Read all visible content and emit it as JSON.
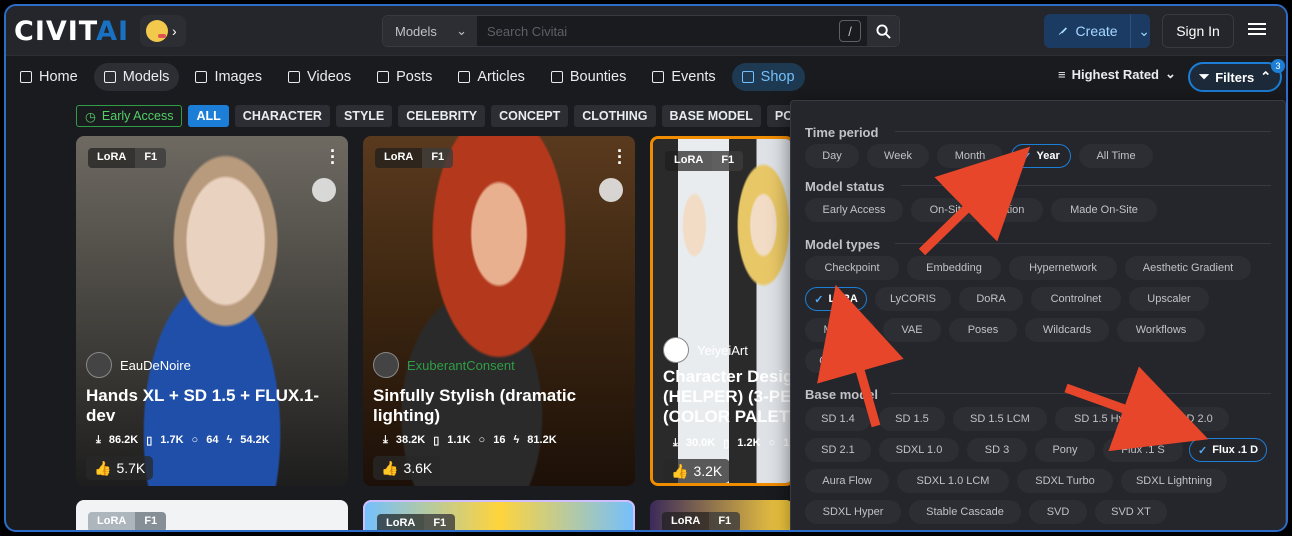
{
  "header": {
    "logo_civit": "CIVIT",
    "logo_ai": "AI",
    "search_select": "Models",
    "search_placeholder": "Search Civitai",
    "search_shortcut": "/",
    "create_label": "Create",
    "signin_label": "Sign In"
  },
  "nav": {
    "items": [
      "Home",
      "Models",
      "Images",
      "Videos",
      "Posts",
      "Articles",
      "Bounties",
      "Events",
      "Shop"
    ],
    "sort_label": "Highest Rated",
    "filters_label": "Filters",
    "filters_count": "3"
  },
  "chips": [
    "Early Access",
    "ALL",
    "CHARACTER",
    "STYLE",
    "CELEBRITY",
    "CONCEPT",
    "CLOTHING",
    "BASE MODEL",
    "POSES"
  ],
  "cards": [
    {
      "tag1": "LoRA",
      "tag2": "F1",
      "author": "EauDeNoire",
      "title": "Hands XL + SD 1.5 + FLUX.1-dev",
      "downloads": "86.2K",
      "saves": "1.7K",
      "comments": "64",
      "buzz": "54.2K",
      "likes": "5.7K"
    },
    {
      "tag1": "LoRA",
      "tag2": "F1",
      "author": "ExuberantConsent",
      "title": "Sinfully Stylish (dramatic lighting)",
      "downloads": "38.2K",
      "saves": "1.1K",
      "comments": "16",
      "buzz": "81.2K",
      "likes": "3.6K"
    },
    {
      "tag1": "LoRA",
      "tag2": "F1",
      "author": "YeiyeiArt",
      "title": "Character Desig (HELPER) (3-PE (COLOR PALETT",
      "downloads": "30.0K",
      "saves": "1.2K",
      "comments": "1",
      "buzz": "",
      "likes": "3.2K"
    },
    {
      "tag1": "LoRA",
      "tag2": "F1"
    },
    {
      "tag1": "LoRA",
      "tag2": "F1"
    },
    {
      "tag1": "LoRA",
      "tag2": "F1"
    }
  ],
  "filters": {
    "time_period": {
      "title": "Time period",
      "options": [
        "Day",
        "Week",
        "Month",
        "Year",
        "All Time"
      ],
      "selected": "Year"
    },
    "model_status": {
      "title": "Model status",
      "options": [
        "Early Access",
        "On-Site Generation",
        "Made On-Site"
      ]
    },
    "model_types": {
      "title": "Model types",
      "options": [
        "Checkpoint",
        "Embedding",
        "Hypernetwork",
        "Aesthetic Gradient",
        "LoRA",
        "LyCORIS",
        "DoRA",
        "Controlnet",
        "Upscaler",
        "Motion",
        "VAE",
        "Poses",
        "Wildcards",
        "Workflows",
        "Other"
      ],
      "selected": "LoRA"
    },
    "base_model": {
      "title": "Base model",
      "options": [
        "SD 1.4",
        "SD 1.5",
        "SD 1.5 LCM",
        "SD 1.5 Hyper",
        "SD 2.0",
        "SD 2.1",
        "SDXL 1.0",
        "SD 3",
        "Pony",
        "Flux .1 S",
        "Flux .1 D",
        "Aura Flow",
        "SDXL 1.0 LCM",
        "SDXL Turbo",
        "SDXL Lightning",
        "SDXL Hyper",
        "Stable Cascade",
        "SVD",
        "SVD XT"
      ],
      "selected": "Flux .1 D"
    }
  },
  "colors": {
    "accent": "#1c7ed6",
    "arrow": "#e8462a",
    "background": "#1a1b1e"
  }
}
